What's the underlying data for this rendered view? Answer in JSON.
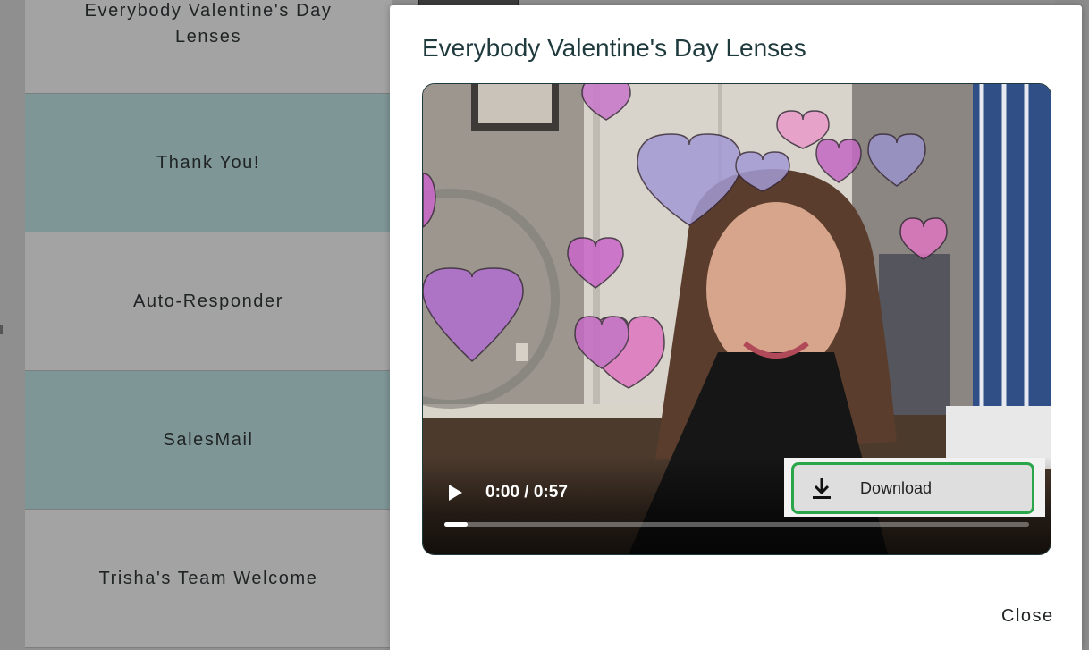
{
  "background_list": {
    "items": [
      {
        "label": "Everybody Valentine's Day Lenses",
        "shade": "light"
      },
      {
        "label": "Thank You!",
        "shade": "teal"
      },
      {
        "label": "Auto-Responder",
        "shade": "light"
      },
      {
        "label": "SalesMail",
        "shade": "teal"
      },
      {
        "label": "Trisha's Team Welcome",
        "shade": "light"
      }
    ]
  },
  "modal": {
    "title": "Everybody Valentine's Day Lenses",
    "close_label": "Close"
  },
  "video": {
    "time_display": "0:00 / 0:57",
    "progress_fraction": 0.04,
    "menu": {
      "download_label": "Download"
    },
    "icons": {
      "play": "play-icon",
      "download": "download-icon"
    }
  },
  "colors": {
    "title": "#1f3a3d",
    "highlight_border": "#2aa54a",
    "row_teal": "#7f9696",
    "row_light": "#a3a3a3"
  }
}
